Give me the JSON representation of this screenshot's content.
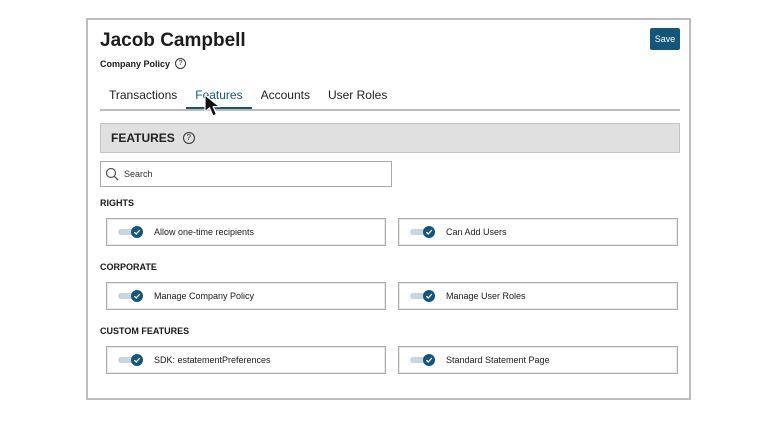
{
  "header": {
    "name": "Jacob Campbell",
    "subtitle": "Company Policy",
    "save_label": "Save"
  },
  "tabs": [
    {
      "label": "Transactions",
      "active": false
    },
    {
      "label": "Features",
      "active": true
    },
    {
      "label": "Accounts",
      "active": false
    },
    {
      "label": "User Roles",
      "active": false
    }
  ],
  "section": {
    "title": "FEATURES"
  },
  "search": {
    "placeholder": "Search"
  },
  "groups": [
    {
      "label": "RIGHTS",
      "items": [
        {
          "label": "Allow one-time recipients",
          "enabled": true
        },
        {
          "label": "Can Add Users",
          "enabled": true
        }
      ]
    },
    {
      "label": "CORPORATE",
      "items": [
        {
          "label": "Manage Company Policy",
          "enabled": true
        },
        {
          "label": "Manage User Roles",
          "enabled": true
        }
      ]
    },
    {
      "label": "CUSTOM FEATURES",
      "items": [
        {
          "label": "SDK: estatementPreferences",
          "enabled": true
        },
        {
          "label": "Standard Statement Page",
          "enabled": true
        }
      ]
    }
  ],
  "colors": {
    "accent": "#14567a",
    "section_bg": "#e0e0e0"
  }
}
